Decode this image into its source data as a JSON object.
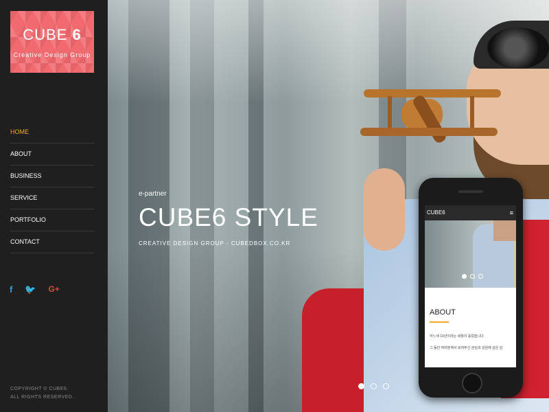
{
  "sidebar": {
    "logo": {
      "title_main": "CUBE",
      "title_num": "6",
      "subtitle": "Creative Design Group"
    },
    "nav": [
      {
        "label": "HOME",
        "active": true
      },
      {
        "label": "ABOUT",
        "active": false
      },
      {
        "label": "BUSINESS",
        "active": false
      },
      {
        "label": "SERVICE",
        "active": false
      },
      {
        "label": "PORTFOLIO",
        "active": false
      },
      {
        "label": "CONTACT",
        "active": false
      }
    ],
    "social": {
      "facebook": "f",
      "twitter": "🐦",
      "google_plus": "G+"
    },
    "copyright_line1": "COPYRIGHT © CUBE6.",
    "copyright_line2": "ALL RIGHTS RESERVED."
  },
  "hero": {
    "eyebrow": "e-partner",
    "headline": "CUBE6 STYLE",
    "subline": "CREATIVE DESIGN GROUP - CUBEDBOX.CO.KR",
    "slides_total": 3,
    "slide_active": 1
  },
  "phone": {
    "logo": "CUBE6",
    "menu_icon": "≡",
    "section_title": "ABOUT",
    "text1": "어느새 10년이라는 세월이 흘렀습니다.",
    "text2": "그 동안 여러분께서 보여주신 관심과 성원에 깊은 감",
    "slides_total": 3,
    "slide_active": 1
  },
  "colors": {
    "accent": "#f5a623",
    "logo_bg": "#f06a6f",
    "sidebar_bg": "#1f1f1f"
  }
}
